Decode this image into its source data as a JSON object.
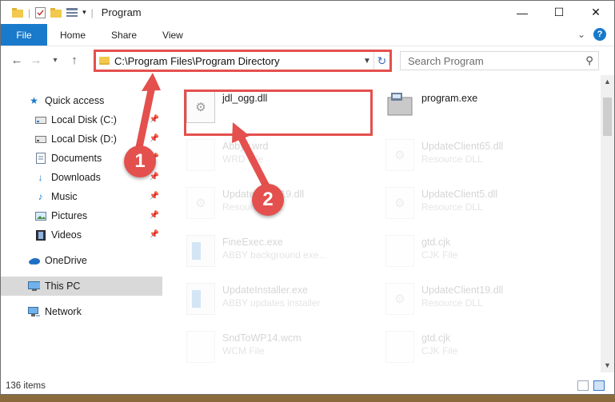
{
  "window": {
    "title": "Program",
    "controls": {
      "minimize": "—",
      "maximize": "☐",
      "close": "✕"
    }
  },
  "ribbon": {
    "tabs": [
      "File",
      "Home",
      "Share",
      "View"
    ],
    "expand_glyph": "⌄",
    "help_glyph": "?"
  },
  "address_bar": {
    "path": "C:\\Program Files\\Program Directory",
    "refresh_glyph": "↻"
  },
  "search": {
    "placeholder": "Search Program"
  },
  "sidebar": {
    "items": [
      {
        "label": "Quick access",
        "icon": "star-icon",
        "pinned": false
      },
      {
        "label": "Local Disk (C:)",
        "icon": "drive-icon",
        "pinned": true
      },
      {
        "label": "Local Disk (D:)",
        "icon": "drive-icon",
        "pinned": true
      },
      {
        "label": "Documents",
        "icon": "documents-icon",
        "pinned": true
      },
      {
        "label": "Downloads",
        "icon": "download-icon",
        "pinned": true
      },
      {
        "label": "Music",
        "icon": "music-icon",
        "pinned": true
      },
      {
        "label": "Pictures",
        "icon": "pictures-icon",
        "pinned": true
      },
      {
        "label": "Videos",
        "icon": "videos-icon",
        "pinned": true
      },
      {
        "label": "OneDrive",
        "icon": "cloud-icon",
        "pinned": false
      },
      {
        "label": "This PC",
        "icon": "monitor-icon",
        "pinned": false,
        "selected": true
      },
      {
        "label": "Network",
        "icon": "network-icon",
        "pinned": false
      }
    ]
  },
  "files": [
    {
      "name": "jdl_ogg.dll",
      "type": "",
      "icon": "dll-gear-icon",
      "highlighted": true
    },
    {
      "name": "program.exe",
      "type": "",
      "icon": "program-icon"
    },
    {
      "name": "Abbyy.wrd",
      "type": "WRD File",
      "icon": "file-icon"
    },
    {
      "name": "UpdateClient65.dll",
      "type": "Resource DLL",
      "icon": "dll-gear-icon"
    },
    {
      "name": "UpdateClient19.dll",
      "type": "Resource DLL",
      "icon": "dll-gear-icon"
    },
    {
      "name": "UpdateClient5.dll",
      "type": "Resource DLL",
      "icon": "dll-gear-icon"
    },
    {
      "name": "FineExec.exe",
      "type": "ABBY background exe...",
      "icon": "exe-icon"
    },
    {
      "name": "gtd.cjk",
      "type": "CJK File",
      "icon": "file-icon"
    },
    {
      "name": "UpdateInstaller.exe",
      "type": "ABBY updates installer",
      "icon": "exe-icon"
    },
    {
      "name": "UpdateClient19.dll",
      "type": "Resource DLL",
      "icon": "dll-gear-icon"
    },
    {
      "name": "SndToWP14.wcm",
      "type": "WCM File",
      "icon": "file-icon"
    },
    {
      "name": "gtd.cjk",
      "type": "CJK File",
      "icon": "file-icon"
    }
  ],
  "markers": [
    "1",
    "2"
  ],
  "status": {
    "item_count": "136 items"
  },
  "colors": {
    "accent": "#1979ca",
    "annotation": "#e3504d",
    "selection": "#d9d9d9"
  }
}
